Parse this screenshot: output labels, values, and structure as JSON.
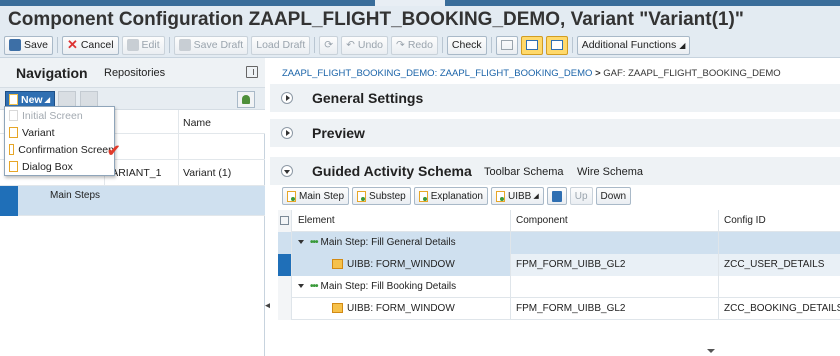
{
  "title": "Component Configuration ZAAPL_FLIGHT_BOOKING_DEMO, Variant \"Variant(1)\"",
  "toolbar": {
    "save": "Save",
    "cancel": "Cancel",
    "edit": "Edit",
    "save_draft": "Save Draft",
    "load_draft": "Load Draft",
    "undo": "Undo",
    "redo": "Redo",
    "check": "Check",
    "additional_functions": "Additional Functions"
  },
  "nav": {
    "title": "Navigation",
    "repositories": "Repositories",
    "new_button": "New",
    "col_name": "Name",
    "rows": [
      {
        "id": "VARIANT_1",
        "name": "Variant (1)"
      }
    ],
    "selected_row": "Main Steps"
  },
  "new_menu": {
    "items": [
      {
        "label": "Initial Screen",
        "enabled": false
      },
      {
        "label": "Variant",
        "enabled": true
      },
      {
        "label": "Confirmation Screen",
        "enabled": true
      },
      {
        "label": "Dialog Box",
        "enabled": true
      }
    ]
  },
  "breadcrumb": {
    "part1": "ZAAPL_FLIGHT_BOOKING_DEMO: ZAAPL_FLIGHT_BOOKING_DEMO",
    "separator": ">",
    "part2": "GAF: ZAAPL_FLIGHT_BOOKING_DEMO"
  },
  "sections": {
    "general": "General Settings",
    "preview": "Preview",
    "gaf": "Guided Activity Schema",
    "toolbar_schema": "Toolbar Schema",
    "wire_schema": "Wire Schema"
  },
  "gaf_toolbar": {
    "main_step": "Main Step",
    "substep": "Substep",
    "explanation": "Explanation",
    "uibb": "UIBB",
    "up": "Up",
    "down": "Down"
  },
  "grid": {
    "headers": {
      "element": "Element",
      "component": "Component",
      "config_id": "Config ID"
    },
    "rows": [
      {
        "element": "Main Step: Fill General Details",
        "component": "",
        "config_id": ""
      },
      {
        "element": "UIBB: FORM_WINDOW",
        "component": "FPM_FORM_UIBB_GL2",
        "config_id": "ZCC_USER_DETAILS"
      },
      {
        "element": "Main Step: Fill Booking Details",
        "component": "",
        "config_id": ""
      },
      {
        "element": "UIBB: FORM_WINDOW",
        "component": "FPM_FORM_UIBB_GL2",
        "config_id": "ZCC_BOOKING_DETAILS"
      }
    ]
  }
}
